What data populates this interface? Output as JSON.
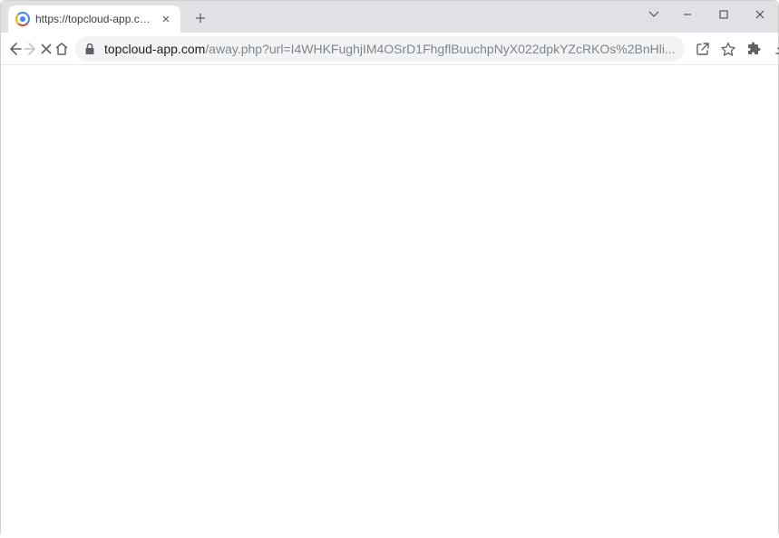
{
  "tab": {
    "title": "https://topcloud-app.com/away"
  },
  "url": {
    "domain": "topcloud-app.com",
    "path": "/away.php?url=I4WHKFughjIM4OSrD1FhgflBuuchpNyX022dpkYZcRKOs%2BnHli..."
  }
}
